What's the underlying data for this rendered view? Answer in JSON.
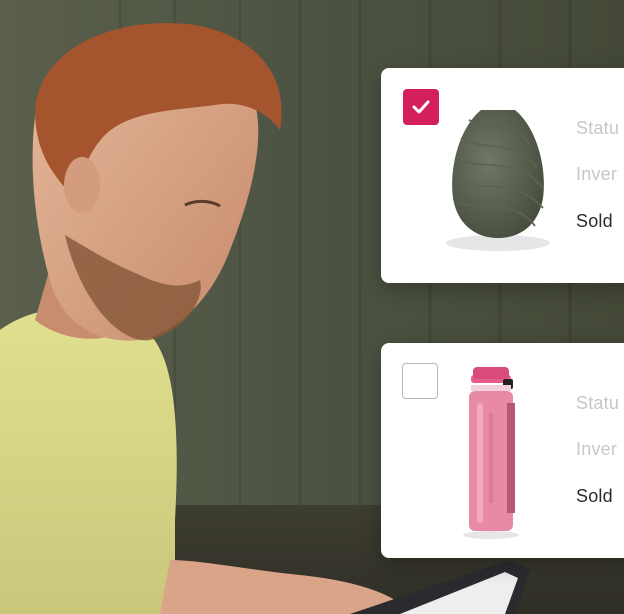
{
  "cards": [
    {
      "checked": true,
      "product": "vase-icon",
      "rows": [
        "Statu",
        "Inver",
        "Sold"
      ]
    },
    {
      "checked": false,
      "product": "water-bottle-icon",
      "rows": [
        "Statu",
        "Inver",
        "Sold"
      ]
    }
  ],
  "colors": {
    "accent": "#d41f5f",
    "muted_text": "#c7c7c7",
    "strong_text": "#2b2b2b",
    "card_bg": "#ffffff"
  }
}
